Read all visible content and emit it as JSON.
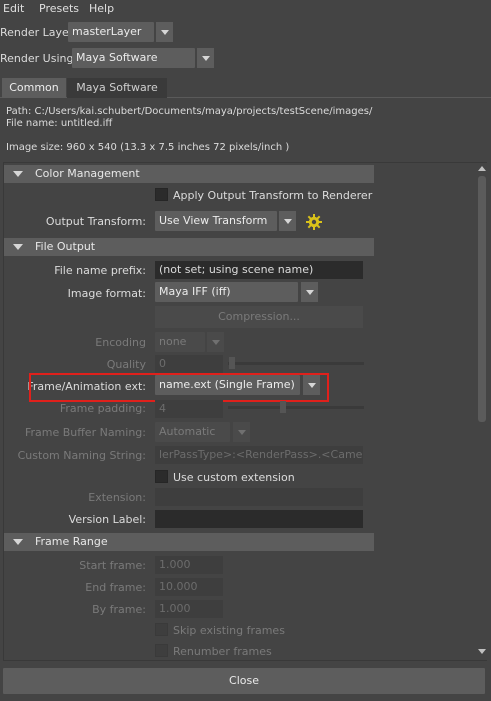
{
  "menu": [
    "Edit",
    "Presets",
    "Help"
  ],
  "render_layer": {
    "label": "Render Layer",
    "value": "masterLayer"
  },
  "render_using": {
    "label": "Render Using",
    "value": "Maya Software"
  },
  "tabs": [
    {
      "label": "Common",
      "active": true
    },
    {
      "label": "Maya Software",
      "active": false
    }
  ],
  "info": {
    "path": "Path: C:/Users/kai.schubert/Documents/maya/projects/testScene/images/",
    "file_name": "File name:  untitled.iff",
    "image_size": "Image size: 960 x 540 (13.3 x 7.5 inches 72 pixels/inch )"
  },
  "color_management": {
    "title": "Color Management",
    "apply_output_transform": "Apply Output Transform to Renderer",
    "output_transform_label": "Output Transform:",
    "output_transform_value": "Use View Transform"
  },
  "file_output": {
    "title": "File Output",
    "file_name_prefix_label": "File name prefix:",
    "file_name_prefix_value": "(not set; using scene name)",
    "image_format_label": "Image format:",
    "image_format_value": "Maya IFF (iff)",
    "compression_label": "Compression...",
    "encoding_label": "Encoding",
    "encoding_value": "none",
    "quality_label": "Quality",
    "quality_value": "0",
    "frame_ext_label": "Frame/Animation ext:",
    "frame_ext_value": "name.ext (Single Frame)",
    "frame_padding_label": "Frame padding:",
    "frame_padding_value": "4",
    "frame_buffer_label": "Frame Buffer Naming:",
    "frame_buffer_value": "Automatic",
    "custom_naming_label": "Custom Naming String:",
    "custom_naming_value": "lerPassType>:<RenderPass>.<Camera>",
    "use_custom_ext": "Use custom extension",
    "extension_label": "Extension:",
    "version_label": "Version Label:"
  },
  "frame_range": {
    "title": "Frame Range",
    "start_label": "Start frame:",
    "start_value": "1.000",
    "end_label": "End frame:",
    "end_value": "10.000",
    "by_label": "By frame:",
    "by_value": "1.000",
    "skip_existing": "Skip existing frames",
    "renumber": "Renumber frames"
  },
  "close_label": "Close",
  "colors": {
    "highlight": "#e0201b",
    "background": "#444444",
    "header": "#5d5d5d"
  }
}
